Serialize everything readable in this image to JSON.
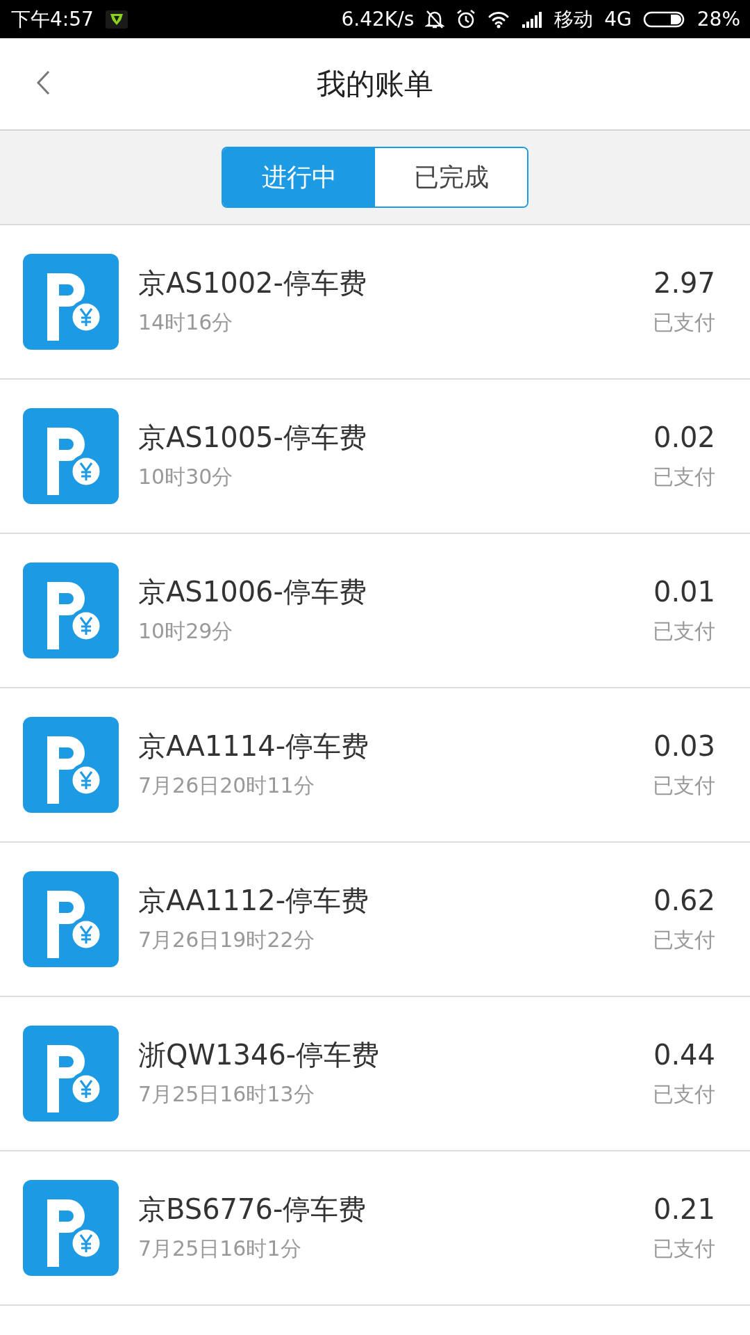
{
  "status_bar": {
    "time": "下午4:57",
    "speed": "6.42K/s",
    "carrier": "移动",
    "network": "4G",
    "battery": "28%"
  },
  "header": {
    "title": "我的账单"
  },
  "tabs": [
    {
      "label": "进行中",
      "selected": true
    },
    {
      "label": "已完成",
      "selected": false
    }
  ],
  "bills": [
    {
      "title": "京AS1002-停车费",
      "time": "14时16分",
      "amount": "2.97",
      "status": "已支付"
    },
    {
      "title": "京AS1005-停车费",
      "time": "10时30分",
      "amount": "0.02",
      "status": "已支付"
    },
    {
      "title": "京AS1006-停车费",
      "time": "10时29分",
      "amount": "0.01",
      "status": "已支付"
    },
    {
      "title": "京AA1114-停车费",
      "time": "7月26日20时11分",
      "amount": "0.03",
      "status": "已支付"
    },
    {
      "title": "京AA1112-停车费",
      "time": "7月26日19时22分",
      "amount": "0.62",
      "status": "已支付"
    },
    {
      "title": "浙QW1346-停车费",
      "time": "7月25日16时13分",
      "amount": "0.44",
      "status": "已支付"
    },
    {
      "title": "京BS6776-停车费",
      "time": "7月25日16时1分",
      "amount": "0.21",
      "status": "已支付"
    }
  ]
}
